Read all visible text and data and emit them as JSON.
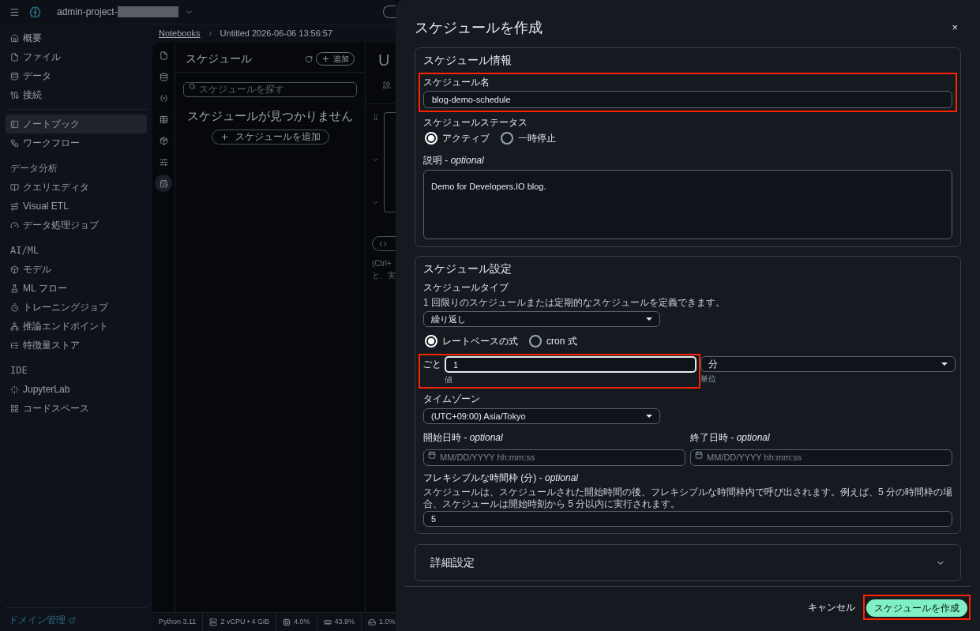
{
  "top_bar": {
    "project": "admin-project-",
    "redacted": true
  },
  "breadcrumb": [
    {
      "label": "Notebooks",
      "link": true
    },
    {
      "label": "Untitled 2026-06-06 13:56:57",
      "link": false
    }
  ],
  "sidebar": {
    "sections": [
      {
        "items": [
          {
            "label": "概要",
            "selected": false
          },
          {
            "label": "ファイル",
            "selected": false
          },
          {
            "label": "データ",
            "selected": false
          },
          {
            "label": "接続",
            "selected": false
          }
        ]
      },
      {
        "items": [
          {
            "label": "ノートブック",
            "selected": true
          },
          {
            "label": "ワークフロー",
            "selected": false
          }
        ]
      },
      {
        "heading": "データ分析",
        "items": [
          {
            "label": "クエリエディタ",
            "selected": false
          },
          {
            "label": "Visual ETL",
            "selected": false
          },
          {
            "label": "データ処理ジョブ",
            "selected": false
          }
        ]
      },
      {
        "heading": "AI/ML",
        "items": [
          {
            "label": "モデル",
            "selected": false
          },
          {
            "label": "ML フロー",
            "selected": false
          },
          {
            "label": "トレーニングジョブ",
            "selected": false
          },
          {
            "label": "推論エンドポイント",
            "selected": false
          },
          {
            "label": "特徴量ストア",
            "selected": false
          }
        ]
      },
      {
        "heading": "IDE",
        "items": [
          {
            "label": "JupyterLab",
            "selected": false
          },
          {
            "label": "コードスペース",
            "selected": false
          }
        ]
      }
    ],
    "footer_link": "ドメイン管理"
  },
  "rail": [
    {
      "kind": "file",
      "selected": false
    },
    {
      "kind": "database",
      "selected": false
    },
    {
      "kind": "variable",
      "selected": false
    },
    {
      "kind": "table",
      "selected": false
    },
    {
      "kind": "package",
      "selected": false
    },
    {
      "kind": "sliders",
      "selected": false
    },
    {
      "kind": "calendar",
      "selected": true
    }
  ],
  "schedule_panel": {
    "title": "スケジュール",
    "add_button": "追加",
    "search_placeholder": "スケジュールを探す",
    "empty_message": "スケジュールが見つかりません",
    "add_schedule_button": "スケジュールを追加"
  },
  "editor": {
    "title": "U",
    "subtitle": "説",
    "hint_lines": [
      "(Ctrl+",
      "と、実"
    ]
  },
  "status_bar": [
    {
      "kind": "text",
      "label": "Python 3.11"
    },
    {
      "kind": "server",
      "label": "2 vCPU • 4 GiB"
    },
    {
      "kind": "cpu",
      "label": "4.0%"
    },
    {
      "kind": "memory",
      "label": "43.9%"
    },
    {
      "kind": "disk",
      "label": "1.0%"
    }
  ],
  "dialog": {
    "title": "スケジュールを作成",
    "close": "×",
    "info_section": {
      "title": "スケジュール情報",
      "name": {
        "label": "スケジュール名",
        "value": "blog-demo-schedule",
        "highlighted": true
      },
      "status": {
        "label": "スケジュールステータス",
        "options": [
          {
            "label": "アクティブ",
            "selected": true
          },
          {
            "label": "一時停止",
            "selected": false
          }
        ]
      },
      "description": {
        "label": "説明 - *optional*",
        "value": "Demo for Developers.IO blog."
      }
    },
    "settings_section": {
      "title": "スケジュール設定",
      "schedule_type": {
        "label": "スケジュールタイプ",
        "hint": "1 回限りのスケジュールまたは定期的なスケジュールを定義できます。",
        "value": "繰り返し"
      },
      "expression": {
        "options": [
          {
            "label": "レートベースの式",
            "selected": true
          },
          {
            "label": "cron 式",
            "selected": false
          }
        ]
      },
      "rate": {
        "prefix": "ごと",
        "value": "1",
        "value_caption": "値",
        "highlighted": true,
        "unit": "分",
        "unit_caption": "単位"
      },
      "timezone": {
        "label": "タイムゾーン",
        "value": "(UTC+09:00) Asia/Tokyo"
      },
      "start": {
        "label": "開始日時 - *optional*",
        "placeholder": "MM/DD/YYYY hh:mm:ss"
      },
      "end": {
        "label": "終了日時 - *optional*",
        "placeholder": "MM/DD/YYYY hh:mm:ss"
      },
      "flex": {
        "label": "フレキシブルな時間枠 (分) - *optional*",
        "description": "スケジュールは、スケジュールされた開始時間の後、フレキシブルな時間枠内で呼び出されます。例えば、5 分の時間枠の場合、スケジュールは開始時刻から 5 分以内に実行されます。",
        "value": "5"
      }
    },
    "advanced": {
      "title": "詳細設定",
      "expanded": false
    },
    "cancel": "キャンセル",
    "create": {
      "label": "スケジュールを作成",
      "highlighted": true
    }
  }
}
